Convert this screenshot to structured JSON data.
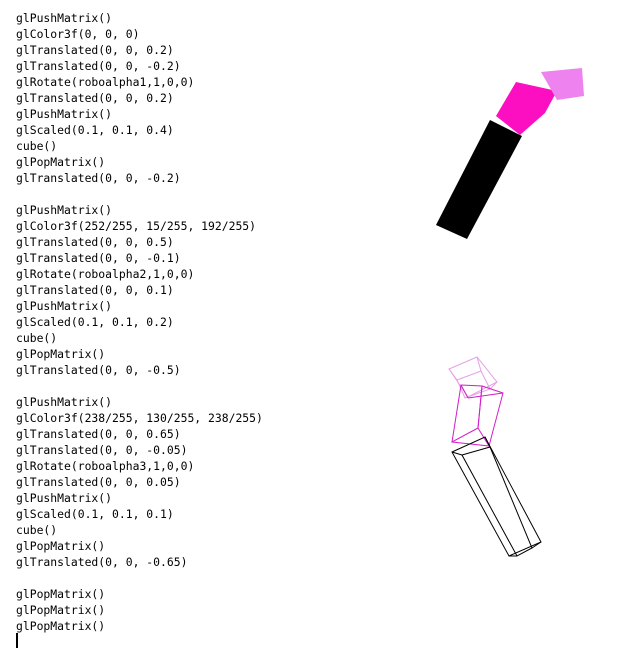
{
  "editor": {
    "lines": [
      "glPushMatrix()",
      "glColor3f(0, 0, 0)",
      "glTranslated(0, 0, 0.2)",
      "glTranslated(0, 0, -0.2)",
      "glRotate(roboalpha1,1,0,0)",
      "glTranslated(0, 0, 0.2)",
      "glPushMatrix()",
      "glScaled(0.1, 0.1, 0.4)",
      "cube()",
      "glPopMatrix()",
      "glTranslated(0, 0, -0.2)",
      "",
      "glPushMatrix()",
      "glColor3f(252/255, 15/255, 192/255)",
      "glTranslated(0, 0, 0.5)",
      "glTranslated(0, 0, -0.1)",
      "glRotate(roboalpha2,1,0,0)",
      "glTranslated(0, 0, 0.1)",
      "glPushMatrix()",
      "glScaled(0.1, 0.1, 0.2)",
      "cube()",
      "glPopMatrix()",
      "glTranslated(0, 0, -0.5)",
      "",
      "glPushMatrix()",
      "glColor3f(238/255, 130/255, 238/255)",
      "glTranslated(0, 0, 0.65)",
      "glTranslated(0, 0, -0.05)",
      "glRotate(roboalpha3,1,0,0)",
      "glTranslated(0, 0, 0.05)",
      "glPushMatrix()",
      "glScaled(0.1, 0.1, 0.1)",
      "cube()",
      "glPopMatrix()",
      "glTranslated(0, 0, -0.65)",
      "",
      "glPopMatrix()",
      "glPopMatrix()",
      "glPopMatrix()"
    ]
  },
  "colors": {
    "segment1": "#000000",
    "segment2": "#fc0fc0",
    "segment3": "#ee82ee",
    "wire_segment1": "#000000",
    "wire_segment2": "#d21ec8",
    "wire_segment3": "#e6a0e6"
  }
}
